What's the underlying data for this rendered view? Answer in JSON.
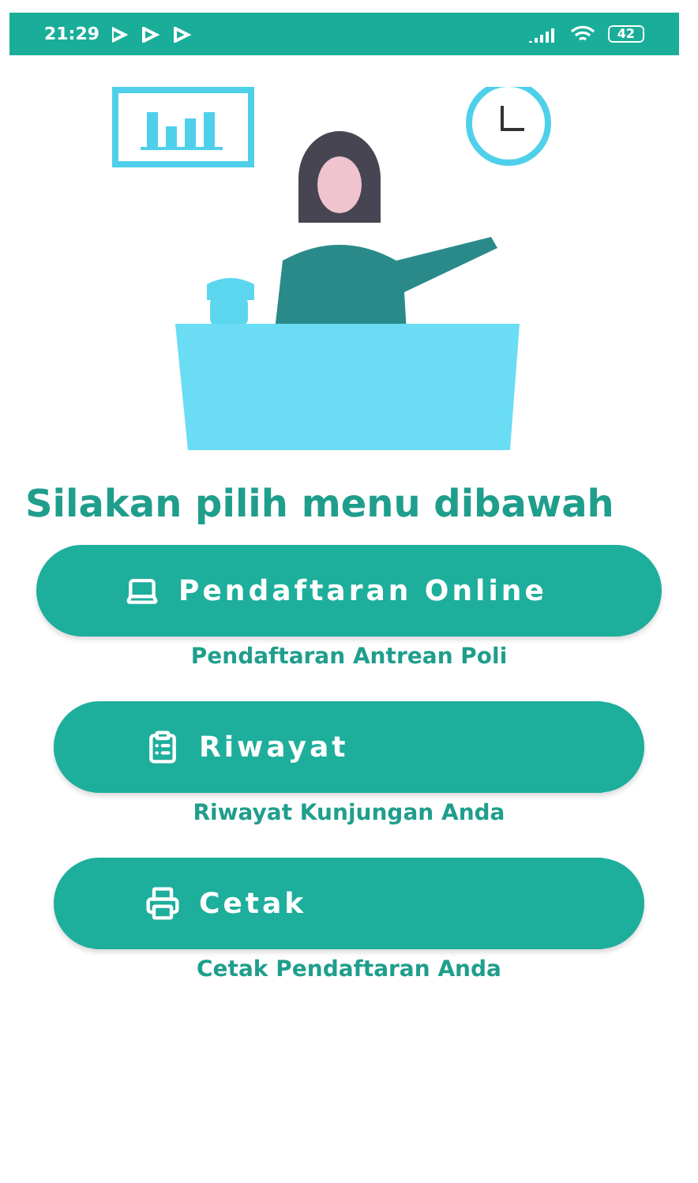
{
  "status_bar": {
    "time": "21:29",
    "battery": "42"
  },
  "heading": "Silakan pilih menu dibawah",
  "menu": [
    {
      "kind": "laptop",
      "label": "Pendaftaran Online",
      "caption": "Pendaftaran Antrean Poli"
    },
    {
      "kind": "clipboard",
      "label": "Riwayat",
      "caption": "Riwayat Kunjungan Anda"
    },
    {
      "kind": "printer",
      "label": "Cetak",
      "caption": "Cetak Pendaftaran Anda"
    }
  ]
}
